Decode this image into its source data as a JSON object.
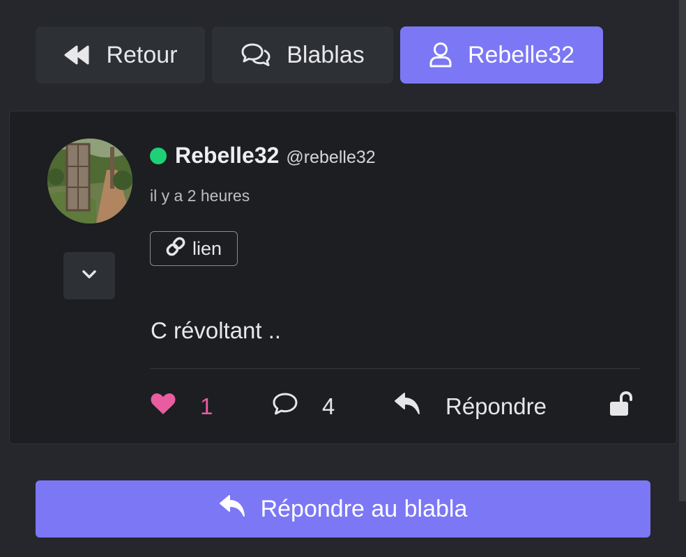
{
  "nav": {
    "back_label": "Retour",
    "blablas_label": "Blablas",
    "user_label": "Rebelle32"
  },
  "post": {
    "author_name": "Rebelle32",
    "author_handle": "@rebelle32",
    "timestamp": "il y a 2 heures",
    "link_label": "lien",
    "message": "C révoltant ..",
    "likes": "1",
    "comments": "4",
    "reply_label": "Répondre"
  },
  "footer": {
    "reply_button_label": "Répondre au blabla"
  },
  "colors": {
    "background": "#25272c",
    "card": "#1c1e22",
    "accent": "#7c77f5",
    "online": "#1ed176",
    "like": "#e85da0"
  },
  "icons": [
    "backward-icon",
    "comments-icon",
    "user-icon",
    "chevron-down-icon",
    "link-icon",
    "heart-icon",
    "comment-icon",
    "reply-icon",
    "unlock-icon"
  ]
}
